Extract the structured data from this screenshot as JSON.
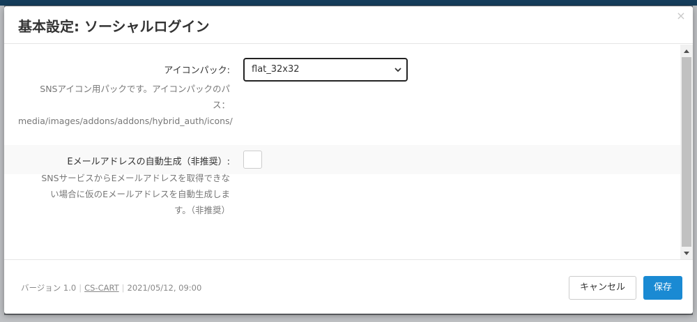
{
  "modal": {
    "title": "基本設定: ソーシャルログイン",
    "close_label": "×"
  },
  "settings": {
    "icon_pack": {
      "label": "アイコンパック:",
      "selected": "flat_32x32",
      "help_lines": [
        "SNSアイコン用パックです。アイコンパックのパ",
        "ス：",
        "media/images/addons/addons/hybrid_auth/icons/"
      ]
    },
    "auto_email": {
      "label": "Eメールアドレスの自動生成（非推奨）:",
      "checked": false,
      "help_lines": [
        "SNSサービスからEメールアドレスを取得できな",
        "い場合に仮のEメールアドレスを自動生成しま",
        "す。（非推奨）"
      ]
    }
  },
  "footer": {
    "version": "バージョン 1.0",
    "vendor": "CS-CART",
    "date": "2021/05/12, 09:00",
    "cancel_label": "キャンセル",
    "save_label": "保存"
  },
  "colors": {
    "primary": "#1a8ad3",
    "header_bar": "#163e5c"
  }
}
